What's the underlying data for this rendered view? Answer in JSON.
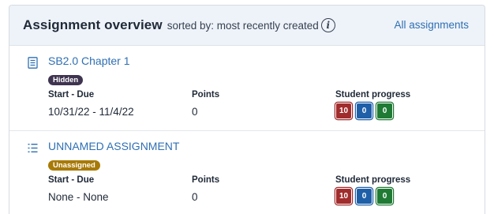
{
  "header": {
    "title": "Assignment overview",
    "subtitle": "sorted by: most recently created",
    "info_icon": "info-circle-icon",
    "link": "All assignments"
  },
  "columns": {
    "start_due": "Start - Due",
    "points": "Points",
    "progress": "Student progress"
  },
  "colors": {
    "link": "#2f6fb3",
    "header_bg": "#eef3f9",
    "badge_hidden": "#3f3450",
    "badge_unassigned": "#a87a06",
    "progress_red": "#a12c2c",
    "progress_blue": "#1f5fa8",
    "progress_green": "#1f7a34"
  },
  "assignments": [
    {
      "icon": "document-icon",
      "name": "SB2.0 Chapter 1",
      "badge": "Hidden",
      "start_due": "10/31/22 - 11/4/22",
      "points": "0",
      "progress": [
        "10",
        "0",
        "0"
      ]
    },
    {
      "icon": "list-icon",
      "name": "UNNAMED ASSIGNMENT",
      "badge": "Unassigned",
      "start_due": "None - None",
      "points": "0",
      "progress": [
        "10",
        "0",
        "0"
      ]
    }
  ]
}
